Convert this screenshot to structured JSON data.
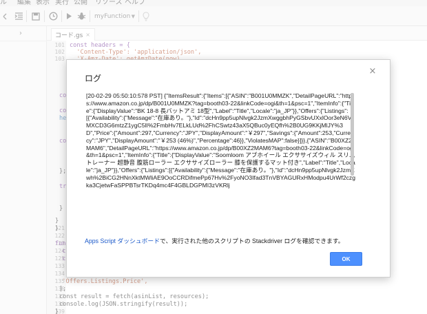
{
  "menu": {
    "items": [
      "ル",
      "編集",
      "表示",
      "実行",
      "公開",
      "リソース",
      "ヘルプ"
    ]
  },
  "toolbar": {
    "function_select": "myFunction",
    "icons": [
      "undo-icon",
      "indent-icon",
      "save-icon",
      "clock-trigger-icon",
      "run-icon",
      "debug-bug-icon",
      "lightbulb-icon"
    ]
  },
  "file_tab": {
    "name": "コード.gs",
    "close": "×"
  },
  "code": {
    "lines": [
      {
        "no": "101",
        "text": "const headers = {"
      },
      {
        "no": "102",
        "text": "  'Content-Type': 'application/json',"
      },
      {
        "no": "103",
        "text": "  'X-Amz-Date': getAmzDate(now),"
      },
      {
        "no": "121",
        "text": "}"
      },
      {
        "no": "122",
        "text": ""
      },
      {
        "no": "123",
        "text": "func"
      },
      {
        "no": "124",
        "text": "  co"
      },
      {
        "no": "125",
        "text": "  co"
      },
      {
        "no": "133",
        "text": ""
      },
      {
        "no": "134",
        "text": ""
      },
      {
        "no": "135",
        "text": "  'Offers.Listings.Price',"
      },
      {
        "no": "136",
        "text": "];"
      },
      {
        "no": "137",
        "text": "const result = fetch(asinList, resources);"
      },
      {
        "no": "138",
        "text": "console.log(JSON.stringify(result));"
      },
      {
        "no": "139",
        "text": "}"
      }
    ],
    "fragments": {
      "f1": "co",
      "f2": "co",
      "f3": "he",
      "f4": "co",
      "f5": "tr",
      "f6": "}",
      "f7": "}",
      "f8": "};"
    }
  },
  "dialog": {
    "title": "ログ",
    "close": "×",
    "log_text": "[20-02-29 05:50:10:578 PST] {\"ItemsResult\":{\"Items\":[{\"ASIN\":\"B001U0MMZK\",\"DetailPageURL\":\"https://www.amazon.co.jp/dp/B001U0MMZK?tag=booth03-22&linkCode=ogi&th=1&psc=1\",\"ItemInfo\":{\"Title\":{\"DisplayValue\":\"BK 18-8 長バットアミ 18型\",\"Label\":\"Title\",\"Locale\":\"ja_JP\"}},\"Offers\":{\"Listings\":[{\"Availability\":{\"Message\":\"在庫あり。\"},\"Id\":\"dcHn9pp5upNlvgk2JzmXwggbhPyGSbvUXxlOor3eN6VMXCD3G6mtzZ1ygC5lI%2FmbHv7ELkLUd%2FhCSwtz43aX5QBuc0yEQfh%2B0UG9KKjMlJY%3D\",\"Price\":{\"Amount\":297,\"Currency\":\"JPY\",\"DisplayAmount\":\"￥297\",\"Savings\":{\"Amount\":253,\"Currency\":\"JPY\",\"DisplayAmount\":\"￥253 (46%)\",\"Percentage\":46}},\"ViolatesMAP\":false}]}},{\"ASIN\":\"B00XZ2MAM6\",\"DetailPageURL\":\"https://www.amazon.co.jp/dp/B00XZ2MAM6?tag=booth03-22&linkCode=ogi&th=1&psc=1\",\"ItemInfo\":{\"Title\":{\"DisplayValue\":\"Soomloom アブホイール エクササイズウィル スリムトレーナー 超静音 腹筋ローラー エクササイズローラー 膝を保護するマット付き\",\"Label\":\"Title\",\"Locale\":\"ja_JP\"}},\"Offers\":{\"Listings\":[{\"Availability\":{\"Message\":\"在庫あり。\"},\"Id\":\"dcHn9pp5upNlvgk2JzmXwh%2BiCG2HNnXktMWliAE9OoCCRDifmePp67Hv%2FyoNO3Ifad3TnVBYAGURxHModpu4UrWf2czgka3CjetwFaSPPBTsrTKDq4mc4F4GBLDGPMI3zVKRlj",
    "note_link": "Apps Script ダッシュボード",
    "note_rest": "で、実行された他のスクリプトの Stackdriver ログを確認できます。",
    "ok_label": "OK"
  }
}
